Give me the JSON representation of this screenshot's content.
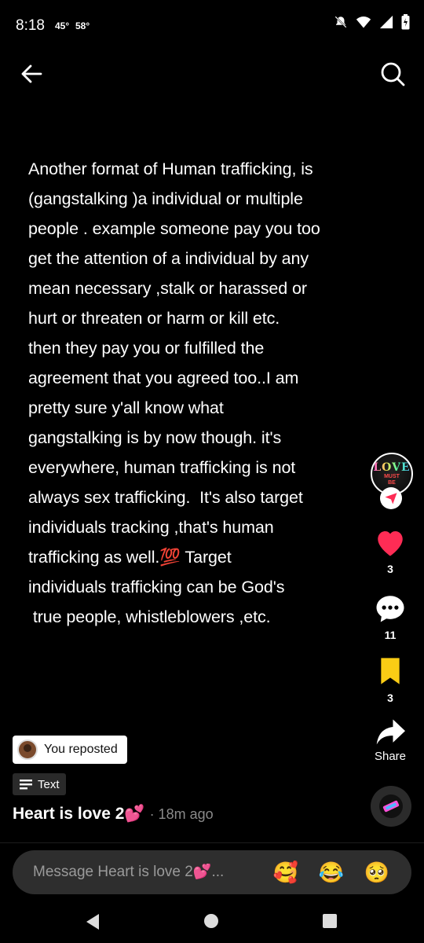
{
  "status_bar": {
    "time": "8:18",
    "temp_1": "45°",
    "temp_2": "58°"
  },
  "header": {
    "back_icon": "arrow-left-icon",
    "search_icon": "search-icon"
  },
  "post": {
    "text": "Another format of Human trafficking, is\n(gangstalking )a individual or multiple\npeople . example someone pay you too\nget the attention of a individual by any\nmean necessary ,stalk or harassed or\nhurt or threaten or harm or kill etc.\nthen they pay you or fulfilled the\nagreement that you agreed too..I am\npretty sure y'all know what\ngangstalking is by now though. it's\neverywhere, human trafficking is not\nalways sex trafficking.  It's also target\nindividuals tracking ,that's human\ntrafficking as well.💯 Target\nindividuals trafficking can be God's\n true people, whistleblowers ,etc."
  },
  "creator_avatar": {
    "line1": "LOVE",
    "line2": "MUST",
    "line3": "BE"
  },
  "actions": {
    "likes": "3",
    "comments": "11",
    "saves": "3",
    "share_label": "Share"
  },
  "repost": {
    "label": "You reposted"
  },
  "content_type": {
    "label": "Text"
  },
  "author": {
    "name": "Heart is love 2💕",
    "time": "· 18m ago"
  },
  "message_bar": {
    "placeholder": "Message Heart is love 2💕...",
    "emojis": [
      "🥰",
      "😂",
      "🥺"
    ]
  },
  "colors": {
    "like": "#fe2c55",
    "save": "#facc15",
    "follow": "#fe2c55"
  }
}
